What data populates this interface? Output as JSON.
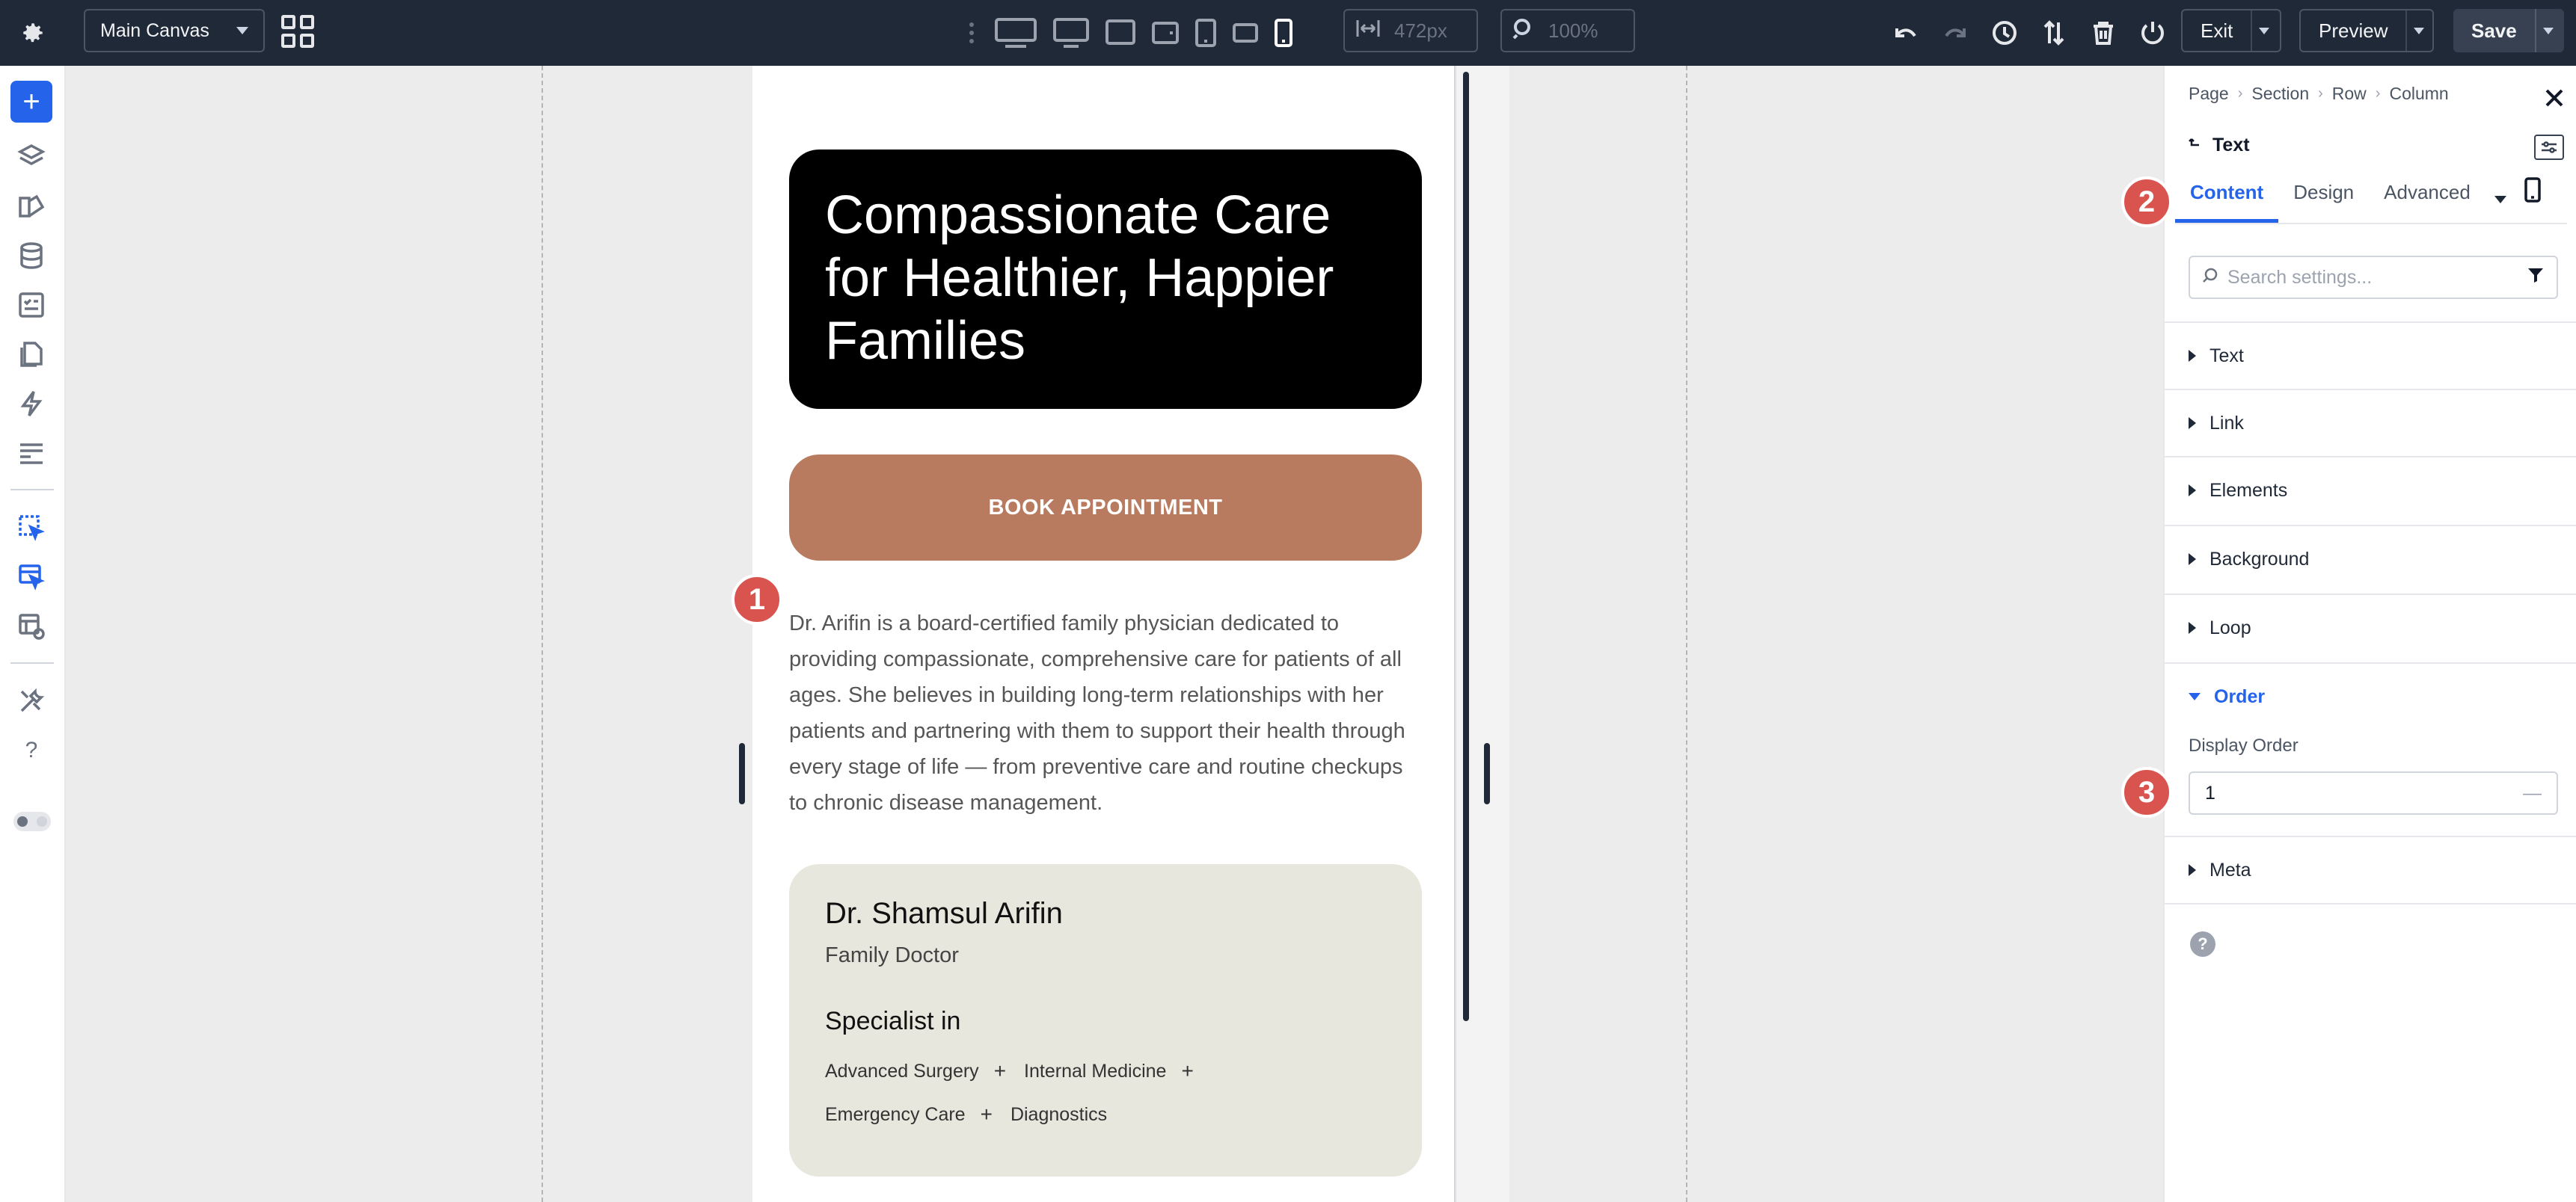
{
  "topbar": {
    "canvas_select": "Main Canvas",
    "width_value": "472px",
    "zoom_value": "100%",
    "exit_label": "Exit",
    "preview_label": "Preview",
    "save_label": "Save"
  },
  "page": {
    "hero_title": "Compassionate Care for Healthier, Happier Families",
    "cta_label": "BOOK APPOINTMENT",
    "bio": "Dr. Arifin is a board-certified family physician dedicated to providing compassionate, comprehensive care for patients of all ages. She believes in building long-term relationships with her patients and partnering with them to support their health through every stage of life — from preventive care and routine checkups to chronic disease management.",
    "doctor_name": "Dr. Shamsul Arifin",
    "doctor_role": "Family Doctor",
    "specialist_heading": "Specialist in",
    "specialties": [
      "Advanced Surgery",
      "Internal Medicine",
      "Emergency Care",
      "Diagnostics"
    ]
  },
  "badges": [
    "1",
    "2",
    "3"
  ],
  "panel": {
    "breadcrumb": [
      "Page",
      "Section",
      "Row",
      "Column"
    ],
    "element_title": "Text",
    "tabs": [
      "Content",
      "Design",
      "Advanced"
    ],
    "active_tab": "Content",
    "search_placeholder": "Search settings...",
    "sections": [
      "Text",
      "Link",
      "Elements",
      "Background",
      "Loop",
      "Order",
      "Meta"
    ],
    "open_section": "Order",
    "order_field_label": "Display Order",
    "order_field_value": "1",
    "help": "?"
  },
  "colors": {
    "accent": "#2563eb",
    "cta": "#b97b5f",
    "badge": "#d9534f",
    "card": "#e8e7dd",
    "topbar": "#1f2937"
  }
}
